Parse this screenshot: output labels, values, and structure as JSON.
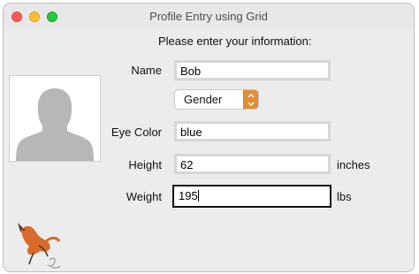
{
  "window": {
    "title": "Profile Entry using Grid"
  },
  "heading": "Please enter your information:",
  "fields": {
    "name": {
      "label": "Name",
      "value": "Bob"
    },
    "gender": {
      "selected": "Gender"
    },
    "eye": {
      "label": "Eye Color",
      "value": "blue"
    },
    "height": {
      "label": "Height",
      "value": "62",
      "unit": "inches"
    },
    "weight": {
      "label": "Weight",
      "value": "195",
      "unit": "lbs"
    }
  },
  "icons": {
    "photo": "person-silhouette-icon",
    "mascot": "fox-icon",
    "dropdown": "chevron-updown-icon"
  },
  "colors": {
    "window_bg": "#ececec",
    "accent_dropdown": "#e08f38",
    "close": "#fe5f57",
    "minimize": "#febc2e",
    "maximize": "#28c840"
  }
}
